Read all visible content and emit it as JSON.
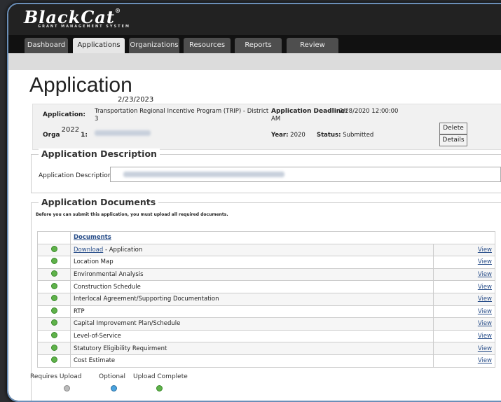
{
  "brand": {
    "name": "BlackCat",
    "reg": "®",
    "sub": "GRANT MANAGEMENT SYSTEM"
  },
  "tabs": [
    {
      "label": "Dashboard"
    },
    {
      "label": "Applications"
    },
    {
      "label": "Organizations"
    },
    {
      "label": "Resources"
    },
    {
      "label": "Reports"
    },
    {
      "label": "Review"
    }
  ],
  "page": {
    "title": "Application"
  },
  "handwriting": {
    "date1": "2/23/2023",
    "year2": "2022"
  },
  "info": {
    "app_label": "Application:",
    "app_value_line1": "Transportation Regional Incentive Program (TRIP) - District",
    "app_value_line2": "3",
    "deadline_label": "Application Deadline:",
    "deadline_value_line1": "2/28/2020 12:00:00",
    "deadline_value_line2": "AM",
    "org_label_prefix": "Orga",
    "org_label_suffix": "1:",
    "year_label": "Year:",
    "year_value": "2020",
    "status_label": "Status:",
    "status_value": "Submitted",
    "delete_label": "Delete",
    "details_label": "Details"
  },
  "description": {
    "section_title": "Application Description",
    "field_label": "Application Description"
  },
  "documents": {
    "section_title": "Application Documents",
    "notice": "Before you can submit this application, you must upload all required documents.",
    "header": "Documents",
    "download_label": "Download",
    "view_label": "View",
    "rows": [
      {
        "name": " - Application"
      },
      {
        "name": "Location Map"
      },
      {
        "name": "Environmental Analysis"
      },
      {
        "name": "Construction Schedule"
      },
      {
        "name": "Interlocal Agreement/Supporting Documentation"
      },
      {
        "name": "RTP"
      },
      {
        "name": "Capital Improvement Plan/Schedule"
      },
      {
        "name": "Level-of-Service"
      },
      {
        "name": "Statutory Eligibility Requirment"
      },
      {
        "name": "Cost Estimate"
      }
    ]
  },
  "legend": {
    "requires_upload": "Requires Upload",
    "optional": "Optional",
    "upload_complete": "Upload Complete"
  },
  "colors": {
    "complete": "#5fb24a",
    "optional": "#4aa3df",
    "requires": "#bbbbbb",
    "link": "#2a4f8a"
  }
}
